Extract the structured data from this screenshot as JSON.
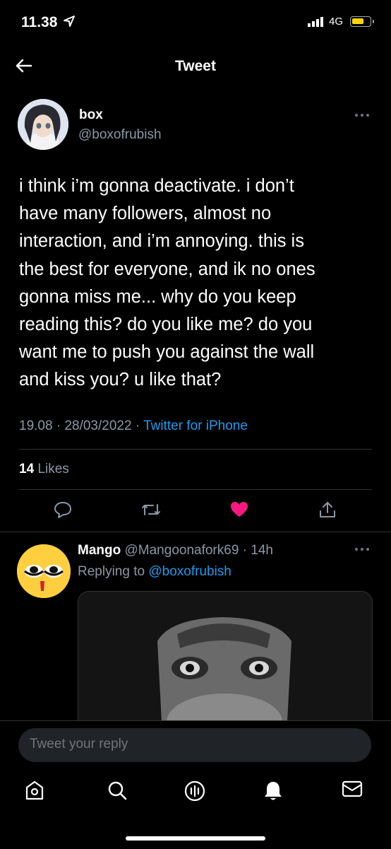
{
  "status_bar": {
    "time": "11.38",
    "network": "4G",
    "location_icon": "location-arrow-icon",
    "battery_color": "#ffd60a"
  },
  "header": {
    "title": "Tweet",
    "back_icon": "arrow-left-icon"
  },
  "tweet": {
    "display_name": "box",
    "handle": "@boxofrubish",
    "text_lines": [
      "i think i’m gonna deactivate. i don’t",
      "have many followers, almost no",
      "interaction, and i’m annoying. this is",
      "the best for everyone, and ik no ones",
      "gonna miss me... why do you keep",
      "reading this? do you like me? do you",
      "want me to push you against the wall",
      "and kiss you? u like that?"
    ],
    "time": "19.08",
    "dot1": " · ",
    "date": "28/03/2022",
    "dot2": " · ",
    "source": "Twitter for iPhone",
    "likes_count": "14",
    "likes_label": " Likes",
    "like_color": "#f91880",
    "link_color": "#1d9bf0"
  },
  "reply": {
    "display_name": "Mango",
    "handle": "@Mangoonafork69",
    "separator": " · ",
    "time": "14h",
    "replying_prefix": "Replying to ",
    "replying_to": "@boxofrubish"
  },
  "composer": {
    "placeholder": "Tweet your reply"
  },
  "nav": [
    "home-icon",
    "search-icon",
    "spaces-icon",
    "notifications-icon",
    "messages-icon"
  ]
}
